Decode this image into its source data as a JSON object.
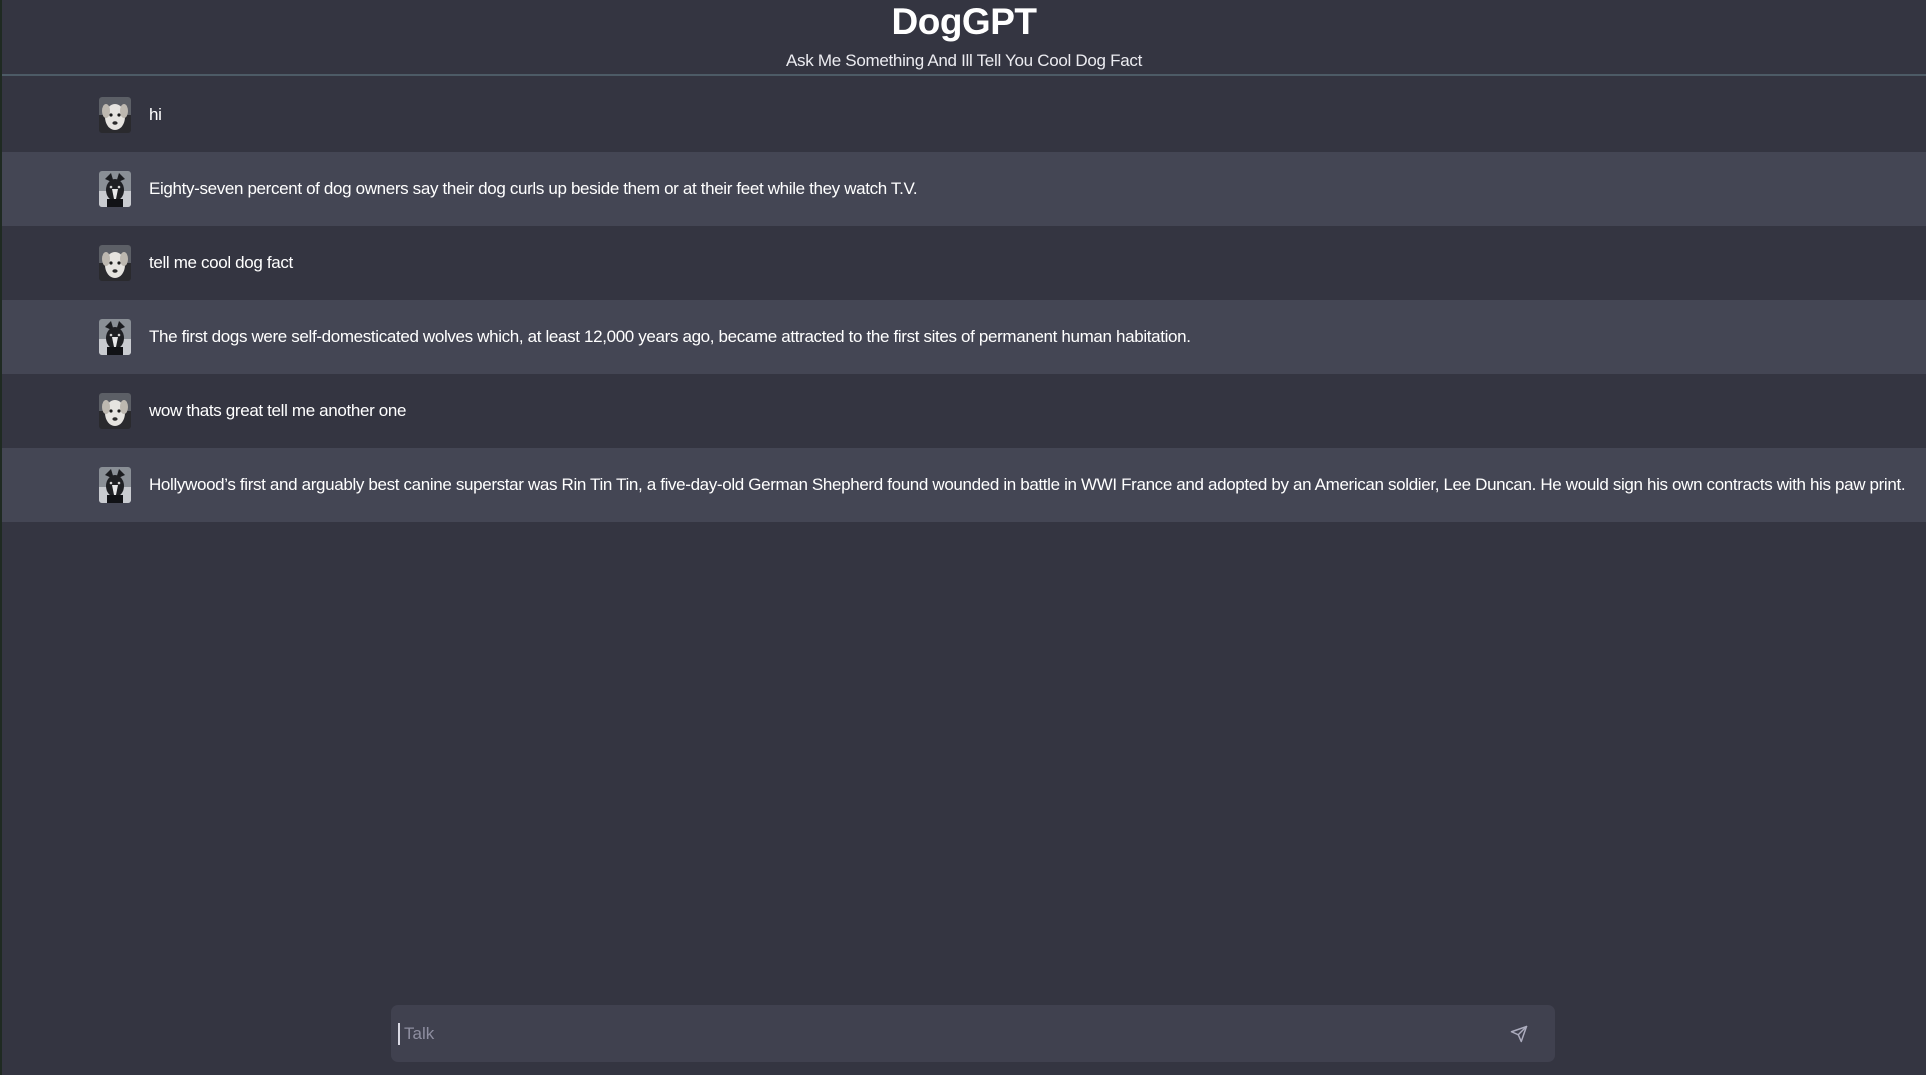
{
  "header": {
    "title": "DogGPT",
    "subtitle": "Ask Me Something And Ill Tell You Cool Dog Fact"
  },
  "messages": [
    {
      "role": "user",
      "avatar": "white-dog-avatar-icon",
      "text": "hi"
    },
    {
      "role": "bot",
      "avatar": "dark-dog-avatar-icon",
      "text": "Eighty-seven percent of dog owners say their dog curls up beside them or at their feet while they watch T.V."
    },
    {
      "role": "user",
      "avatar": "white-dog-avatar-icon",
      "text": "tell me cool dog fact"
    },
    {
      "role": "bot",
      "avatar": "dark-dog-avatar-icon",
      "text": "The first dogs were self-domesticated wolves which, at least 12,000 years ago, became attracted to the first sites of permanent human habitation."
    },
    {
      "role": "user",
      "avatar": "white-dog-avatar-icon",
      "text": "wow thats great tell me another one"
    },
    {
      "role": "bot",
      "avatar": "dark-dog-avatar-icon",
      "text": "Hollywood’s first and arguably best canine superstar was Rin Tin Tin, a five-day-old German Shepherd found wounded in battle in WWI France and adopted by an American soldier, Lee Duncan. He would sign his own contracts with his paw print."
    }
  ],
  "composer": {
    "placeholder": "Talk",
    "value": "",
    "send_icon": "send-icon"
  },
  "colors": {
    "background": "#343541",
    "bot_row": "#444654",
    "input_bg": "#40414f",
    "text": "#ffffff"
  }
}
